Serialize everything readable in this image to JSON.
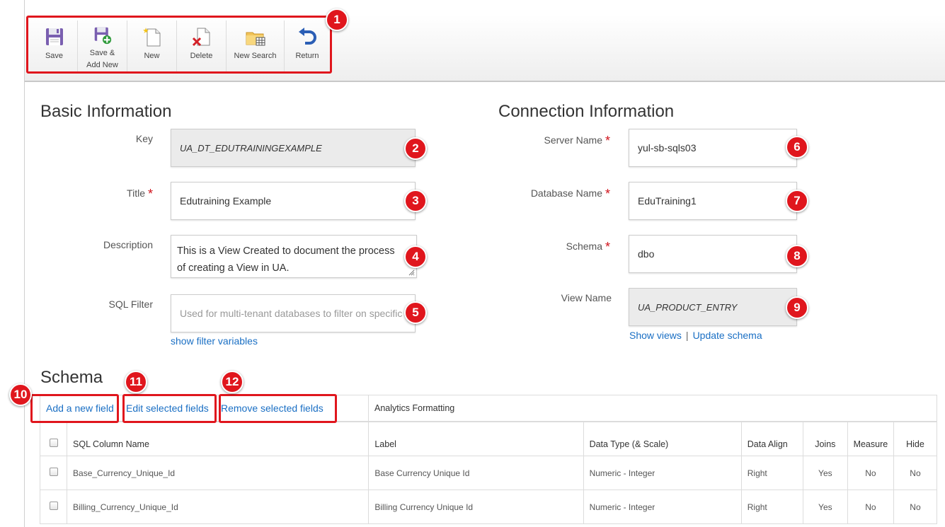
{
  "toolbar": {
    "buttons": [
      {
        "label": "Save",
        "icon": "floppy-disk-icon"
      },
      {
        "label": "Save &",
        "label2": "Add New",
        "icon": "floppy-disk-add-icon"
      },
      {
        "label": "New",
        "icon": "new-document-icon"
      },
      {
        "label": "Delete",
        "icon": "delete-document-icon"
      },
      {
        "label": "New Search",
        "icon": "folder-search-icon"
      },
      {
        "label": "Return",
        "icon": "return-arrow-icon"
      }
    ]
  },
  "callouts": [
    "1",
    "2",
    "3",
    "4",
    "5",
    "6",
    "7",
    "8",
    "9",
    "10",
    "11",
    "12"
  ],
  "basic_info": {
    "heading": "Basic Information",
    "key_label": "Key",
    "key_value": "UA_DT_EDUTRAININGEXAMPLE",
    "title_label": "Title",
    "title_value": "Edutraining Example",
    "description_label": "Description",
    "description_value": "This is a View Created to document the process of creating a View in UA.",
    "sql_filter_label": "SQL Filter",
    "sql_filter_placeholder": "Used for multi-tenant databases to filter on specific tenant",
    "show_filter_variables": "show filter variables"
  },
  "connection_info": {
    "heading": "Connection Information",
    "server_label": "Server Name",
    "server_value": "yul-sb-sqls03",
    "database_label": "Database Name",
    "database_value": "EduTraining1",
    "schema_label": "Schema",
    "schema_value": "dbo",
    "view_label": "View Name",
    "view_value": "UA_PRODUCT_ENTRY",
    "show_views": "Show views",
    "separator": "|",
    "update_schema": "Update schema"
  },
  "required_marker": "*",
  "schema": {
    "heading": "Schema",
    "add_field": "Add a new field",
    "edit_fields": "Edit selected fields",
    "remove_fields": "Remove selected fields",
    "analytics_formatting": "Analytics Formatting",
    "columns": [
      "SQL Column Name",
      "Label",
      "Data Type (& Scale)",
      "Data Align",
      "Joins",
      "Measure",
      "Hide"
    ],
    "rows": [
      {
        "sql": "Base_Currency_Unique_Id",
        "label": "Base Currency Unique Id",
        "type": "Numeric - Integer",
        "align": "Right",
        "joins": "Yes",
        "measure": "No",
        "hide": "No"
      },
      {
        "sql": "Billing_Currency_Unique_Id",
        "label": "Billing Currency Unique Id",
        "type": "Numeric - Integer",
        "align": "Right",
        "joins": "Yes",
        "measure": "No",
        "hide": "No"
      }
    ]
  },
  "colors": {
    "accent_red": "#e0161d",
    "link_blue": "#1a6fc4",
    "readonly_bg": "#ebebeb"
  }
}
